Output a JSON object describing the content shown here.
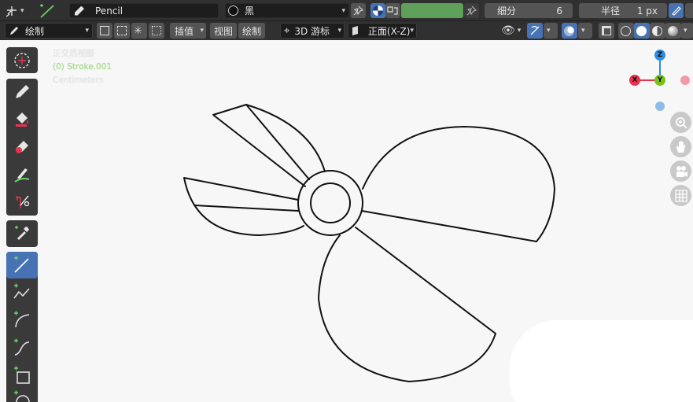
{
  "topbar": {
    "brush_name": "Pencil",
    "material_name": "黑",
    "subdivisions_label": "细分",
    "subdivisions_value": "6",
    "radius_label": "半径",
    "radius_value": "1 px",
    "color_swatch": "#5ea05a"
  },
  "header": {
    "mode_label": "绘制",
    "interpolate_label": "插值",
    "view_label": "视图",
    "draw_label": "绘制",
    "cursor_label": "3D 游标",
    "orientation_label": "正面(X-Z)"
  },
  "viewport": {
    "view_name": "正交后视图",
    "object_name": "(0) Stroke.001",
    "units": "Centimeters"
  },
  "gizmo": {
    "z_label": "Z",
    "x_label": "X",
    "y_label": "Y",
    "z_color": "#2f8de5",
    "x_color": "#e8324e",
    "y_color": "#79c21c"
  },
  "colors": {
    "accent": "#4772b3",
    "tool_icon_green": "#6bd26b"
  }
}
